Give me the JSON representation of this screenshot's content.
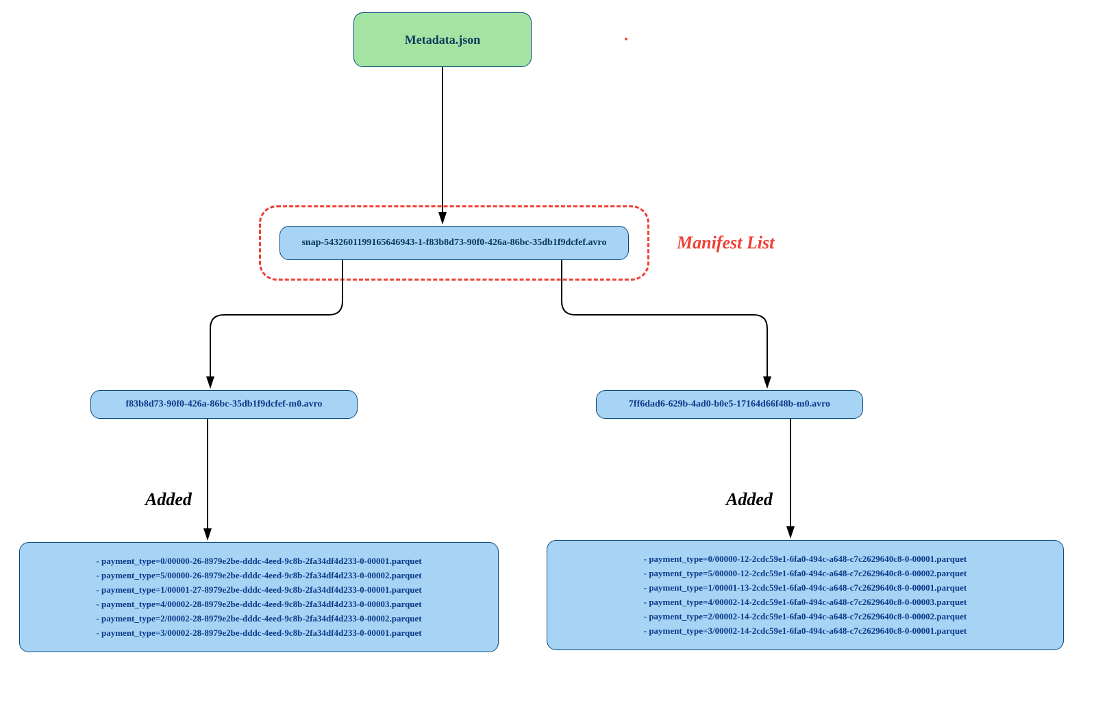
{
  "metadata": {
    "label": "Metadata.json"
  },
  "manifest_list": {
    "label": "Manifest List",
    "snap_file": "snap-5432601199165646943-1-f83b8d73-90f0-426a-86bc-35db1f9dcfef.avro"
  },
  "manifests": {
    "left": "f83b8d73-90f0-426a-86bc-35db1f9dcfef-m0.avro",
    "right": "7ff6dad6-629b-4ad0-b0e5-17164d66f48b-m0.avro"
  },
  "added_label": "Added",
  "files_left": [
    "- payment_type=0/00000-26-8979e2be-dddc-4eed-9c8b-2fa34df4d233-0-00001.parquet",
    "- payment_type=5/00000-26-8979e2be-dddc-4eed-9c8b-2fa34df4d233-0-00002.parquet",
    "- payment_type=1/00001-27-8979e2be-dddc-4eed-9c8b-2fa34df4d233-0-00001.parquet",
    "- payment_type=4/00002-28-8979e2be-dddc-4eed-9c8b-2fa34df4d233-0-00003.parquet",
    "- payment_type=2/00002-28-8979e2be-dddc-4eed-9c8b-2fa34df4d233-0-00002.parquet",
    "- payment_type=3/00002-28-8979e2be-dddc-4eed-9c8b-2fa34df4d233-0-00001.parquet"
  ],
  "files_right": [
    "- payment_type=0/00000-12-2cdc59e1-6fa0-494c-a648-c7c2629640c8-0-00001.parquet",
    "- payment_type=5/00000-12-2cdc59e1-6fa0-494c-a648-c7c2629640c8-0-00002.parquet",
    "- payment_type=1/00001-13-2cdc59e1-6fa0-494c-a648-c7c2629640c8-0-00001.parquet",
    "- payment_type=4/00002-14-2cdc59e1-6fa0-494c-a648-c7c2629640c8-0-00003.parquet",
    "- payment_type=2/00002-14-2cdc59e1-6fa0-494c-a648-c7c2629640c8-0-00002.parquet",
    "- payment_type=3/00002-14-2cdc59e1-6fa0-494c-a648-c7c2629640c8-0-00001.parquet"
  ]
}
